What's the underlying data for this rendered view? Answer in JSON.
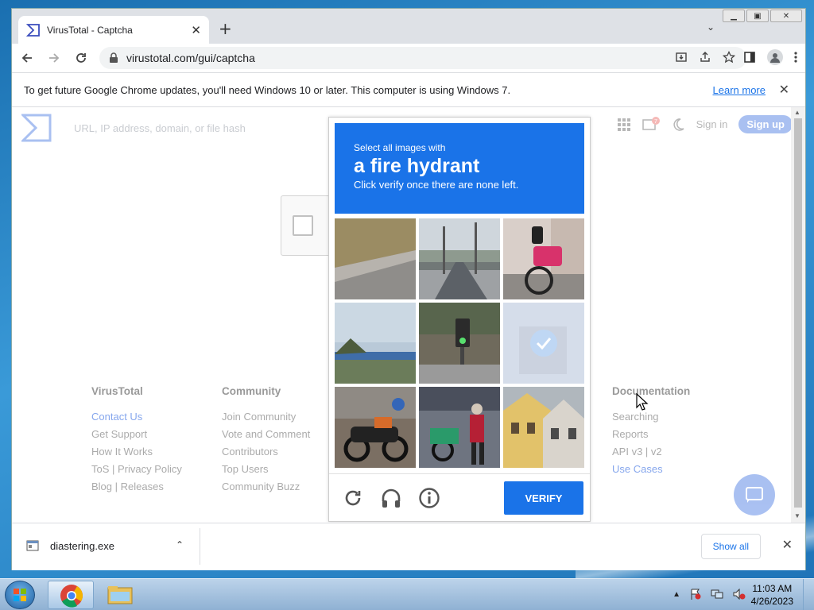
{
  "browser": {
    "tab_title": "VirusTotal - Captcha",
    "url": "virustotal.com/gui/captcha",
    "new_tab": "+",
    "tab_close": "✕"
  },
  "infobar": {
    "message": "To get future Google Chrome updates, you'll need Windows 10 or later. This computer is using Windows 7.",
    "link": "Learn more"
  },
  "vt": {
    "search_placeholder": "URL, IP address, domain, or file hash",
    "sign_in": "Sign in",
    "sign_up": "Sign up",
    "notification_count": "7",
    "footer": [
      {
        "heading": "VirusTotal",
        "links": [
          {
            "label": "Contact Us",
            "accent": true
          },
          {
            "label": "Get Support",
            "accent": false
          },
          {
            "label": "How It Works",
            "accent": false
          },
          {
            "label": "ToS | Privacy Policy",
            "accent": false
          },
          {
            "label": "Blog | Releases",
            "accent": false
          }
        ]
      },
      {
        "heading": "Community",
        "links": [
          {
            "label": "Join Community",
            "accent": false
          },
          {
            "label": "Vote and Comment",
            "accent": false
          },
          {
            "label": "Contributors",
            "accent": false
          },
          {
            "label": "Top Users",
            "accent": false
          },
          {
            "label": "Community Buzz",
            "accent": false
          }
        ]
      },
      {
        "heading": "Documentation",
        "links": [
          {
            "label": "Searching",
            "accent": false
          },
          {
            "label": "Reports",
            "accent": false
          },
          {
            "label": "API v3 | v2",
            "accent": false
          },
          {
            "label": "Use Cases",
            "accent": true
          }
        ]
      }
    ]
  },
  "captcha": {
    "prompt": "Select all images with",
    "target": "a fire hydrant",
    "note": "Click verify once there are none left.",
    "verify": "VERIFY",
    "tiles": [
      {
        "scene": "grassy-slope-road",
        "selected": false
      },
      {
        "scene": "city-street",
        "selected": false
      },
      {
        "scene": "pink-bicycle",
        "selected": false
      },
      {
        "scene": "highway-overpass",
        "selected": false
      },
      {
        "scene": "traffic-light",
        "selected": false
      },
      {
        "scene": "selected-tile",
        "selected": true
      },
      {
        "scene": "motorcycle",
        "selected": false
      },
      {
        "scene": "scooter-riders",
        "selected": false
      },
      {
        "scene": "houses",
        "selected": false
      }
    ]
  },
  "download": {
    "filename": "diastering.exe",
    "show_all": "Show all"
  },
  "taskbar": {
    "time": "11:03 AM",
    "date": "4/26/2023"
  },
  "colors": {
    "accent": "#1a73e8",
    "vt_blue": "#0b4dda"
  }
}
